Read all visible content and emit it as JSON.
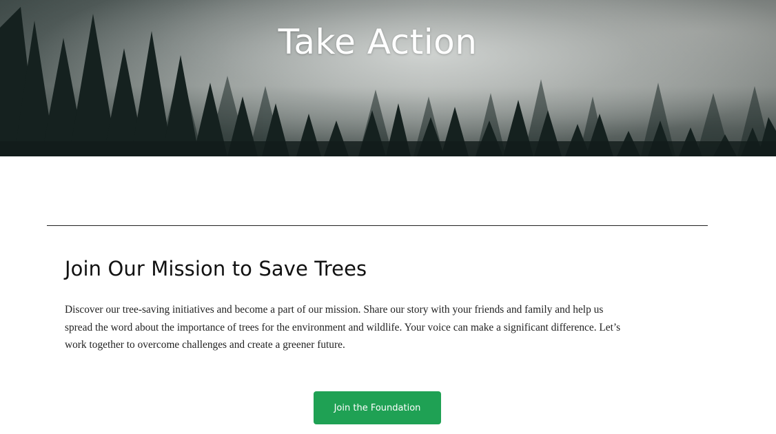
{
  "hero": {
    "title": "Take Action"
  },
  "mission": {
    "heading": "Join Our Mission to Save Trees",
    "body": "Discover our tree-saving initiatives and become a part of our mission. Share our story with your friends and family and help us spread the word about the importance of trees for the environment and wildlife. Your voice can make a significant difference. Let’s work together to overcome challenges and create a greener future."
  },
  "cta": {
    "label": "Join the Foundation",
    "color": "#1fa154"
  },
  "colors": {
    "divider": "#1f1f1f",
    "text": "#111111"
  }
}
